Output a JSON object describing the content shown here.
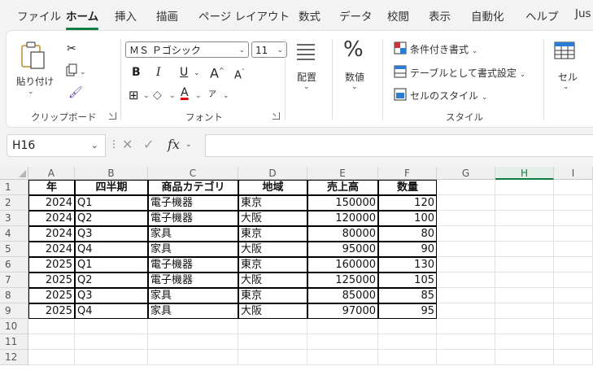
{
  "tabs": [
    "ファイル",
    "ホーム",
    "挿入",
    "描画",
    "ページ レイアウト",
    "数式",
    "データ",
    "校閲",
    "表示",
    "自動化",
    "ヘルプ",
    "Jus"
  ],
  "active_tab": "ホーム",
  "ribbon": {
    "clipboard": {
      "paste": "貼り付け",
      "group": "クリップボード"
    },
    "font": {
      "name": "ＭＳ Ｐゴシック",
      "size": "11",
      "group": "フォント",
      "bold": "B",
      "italic": "I",
      "underline": "U",
      "grow": "A^",
      "shrink": "Aˇ"
    },
    "alignment": {
      "label": "配置"
    },
    "number": {
      "label": "数値",
      "glyph": "%"
    },
    "styles": {
      "conditional": "条件付き書式",
      "table": "テーブルとして書式設定",
      "cell_styles": "セルのスタイル",
      "group": "スタイル"
    },
    "cells": {
      "label": "セル"
    }
  },
  "formula_bar": {
    "name_box": "H16",
    "cancel": "✕",
    "enter": "✓",
    "fx": "fx",
    "formula": ""
  },
  "columns": [
    "A",
    "B",
    "C",
    "D",
    "E",
    "F",
    "G",
    "H",
    "I"
  ],
  "selected_column": "H",
  "rows": [
    "1",
    "2",
    "3",
    "4",
    "5",
    "6",
    "7",
    "8",
    "9",
    "10",
    "11",
    "12"
  ],
  "table": {
    "headers": [
      "年",
      "四半期",
      "商品カテゴリ",
      "地域",
      "売上高",
      "数量"
    ],
    "data": [
      [
        "2024",
        "Q1",
        "電子機器",
        "東京",
        "150000",
        "120"
      ],
      [
        "2024",
        "Q2",
        "電子機器",
        "大阪",
        "120000",
        "100"
      ],
      [
        "2024",
        "Q3",
        "家具",
        "東京",
        "80000",
        "80"
      ],
      [
        "2024",
        "Q4",
        "家具",
        "大阪",
        "95000",
        "90"
      ],
      [
        "2025",
        "Q1",
        "電子機器",
        "東京",
        "160000",
        "130"
      ],
      [
        "2025",
        "Q2",
        "電子機器",
        "大阪",
        "125000",
        "105"
      ],
      [
        "2025",
        "Q3",
        "家具",
        "東京",
        "85000",
        "85"
      ],
      [
        "2025",
        "Q4",
        "家具",
        "大阪",
        "97000",
        "95"
      ]
    ]
  },
  "colors": {
    "accent": "#107c41",
    "ribbon_bg": "#ffffff",
    "app_bg": "#f3f3f3"
  }
}
